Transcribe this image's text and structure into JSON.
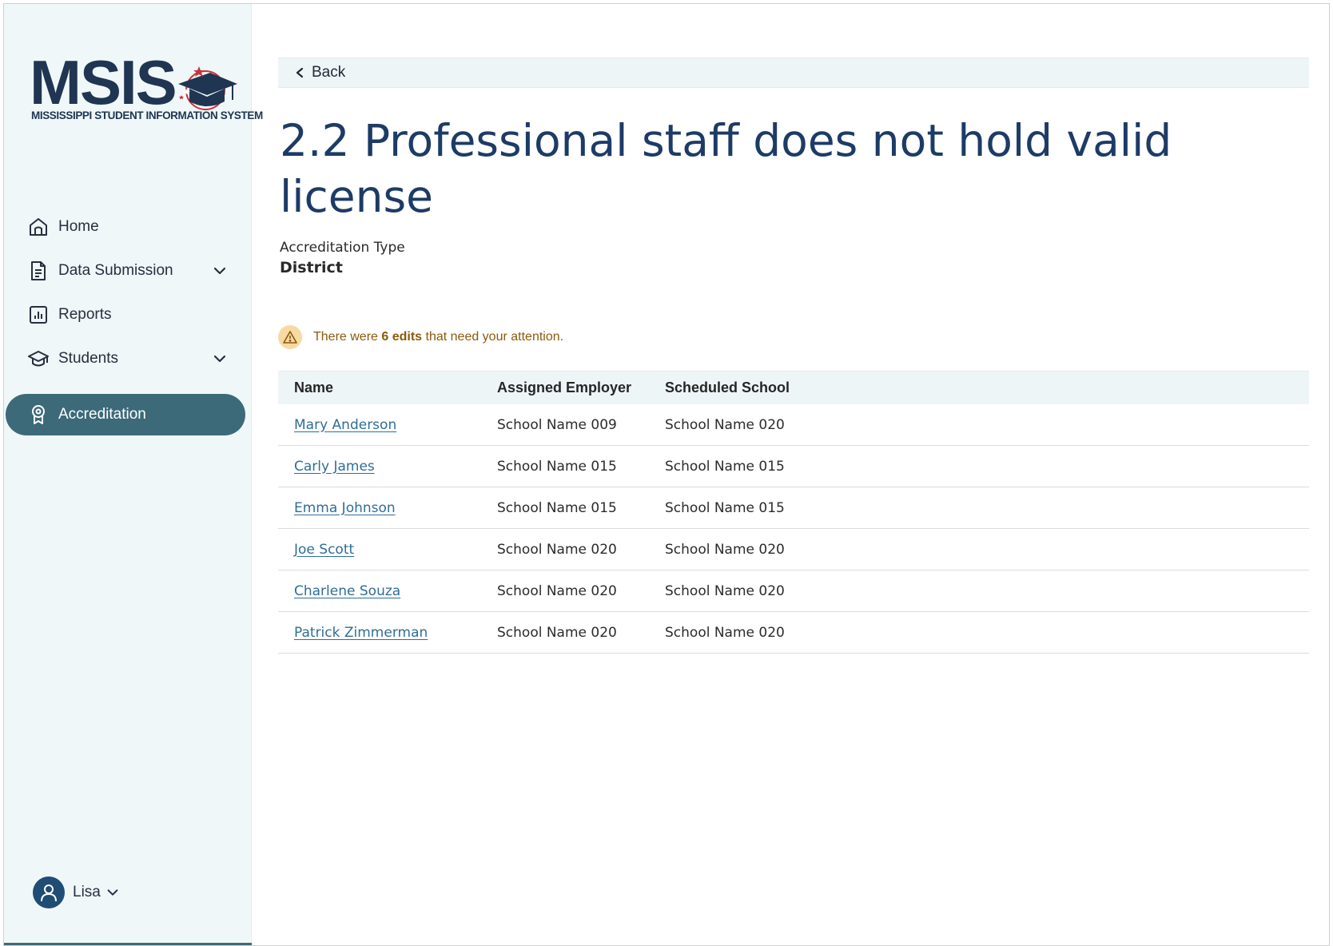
{
  "logo": {
    "title": "MSIS",
    "subtitle": "MISSISSIPPI STUDENT INFORMATION SYSTEM"
  },
  "sidebar": {
    "items": [
      {
        "label": "Home",
        "icon": "home-icon"
      },
      {
        "label": "Data Submission",
        "icon": "document-icon",
        "expandable": true
      },
      {
        "label": "Reports",
        "icon": "bar-chart-icon"
      },
      {
        "label": "Students",
        "icon": "graduation-cap-icon",
        "expandable": true
      },
      {
        "label": "Accreditation",
        "icon": "award-ribbon-icon",
        "active": true
      }
    ],
    "user": {
      "name": "Lisa"
    }
  },
  "header": {
    "back_label": "Back",
    "title": "2.2 Professional staff does not hold valid license",
    "accreditation_type_label": "Accreditation Type",
    "accreditation_type_value": "District"
  },
  "alert": {
    "prefix": "There were ",
    "highlight": "6 edits",
    "suffix": " that need your attention."
  },
  "table": {
    "columns": [
      "Name",
      "Assigned Employer",
      "Scheduled School"
    ],
    "rows": [
      {
        "name": "Mary Anderson",
        "employer": "School Name 009",
        "school": "School Name 020"
      },
      {
        "name": "Carly James",
        "employer": "School Name 015",
        "school": "School Name 015"
      },
      {
        "name": "Emma Johnson",
        "employer": "School Name 015",
        "school": "School Name 015"
      },
      {
        "name": "Joe Scott",
        "employer": "School Name 020",
        "school": "School Name 020"
      },
      {
        "name": "Charlene Souza",
        "employer": "School Name 020",
        "school": "School Name 020"
      },
      {
        "name": "Patrick Zimmerman",
        "employer": "School Name 020",
        "school": "School Name 020"
      }
    ]
  },
  "colors": {
    "brand_navy": "#1d3b66",
    "active_nav": "#3c6a79",
    "sidebar_bg": "#f0f7f8",
    "link": "#2f6e98",
    "warning_text": "#8a5a0c",
    "warning_bg": "#f9d9a3"
  }
}
